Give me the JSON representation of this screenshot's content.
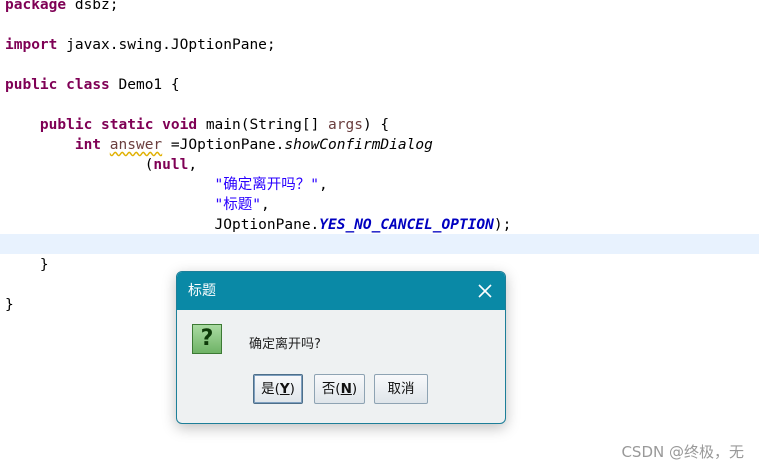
{
  "code": {
    "package_kw": "package",
    "package_name": " dsbz;",
    "import_kw": "import",
    "import_path": " javax.swing.JOptionPane;",
    "public_kw": "public",
    "class_kw": "class",
    "class_name": " Demo1 {",
    "static_kw": "static",
    "void_kw": "void",
    "main_sig_a": " main(String[] ",
    "args": "args",
    "main_sig_b": ") {",
    "int_kw": "int",
    "answer": "answer",
    "assign": " =JOptionPane.",
    "method": "showConfirmDialog",
    "paren_open": "(",
    "null_kw": "null",
    "comma": ",",
    "str1": "\"确定离开吗？\"",
    "str2": "\"标题\"",
    "opt_prefix": "JOptionPane.",
    "opt_const": "YES_NO_CANCEL_OPTION",
    "opt_suffix": ");",
    "close_method": "}",
    "close_class": "}"
  },
  "dialog": {
    "title": "标题",
    "message": "确定离开吗?",
    "icon": "question-icon",
    "icon_glyph": "?",
    "buttons": {
      "yes_label": "是(",
      "yes_mnemonic": "Y",
      "yes_end": ")",
      "no_label": "否(",
      "no_mnemonic": "N",
      "no_end": ")",
      "cancel_label": "取消"
    },
    "colors": {
      "titlebar": "#0a89a6",
      "border": "#1d7f99"
    }
  },
  "watermark": "CSDN @终极，无"
}
